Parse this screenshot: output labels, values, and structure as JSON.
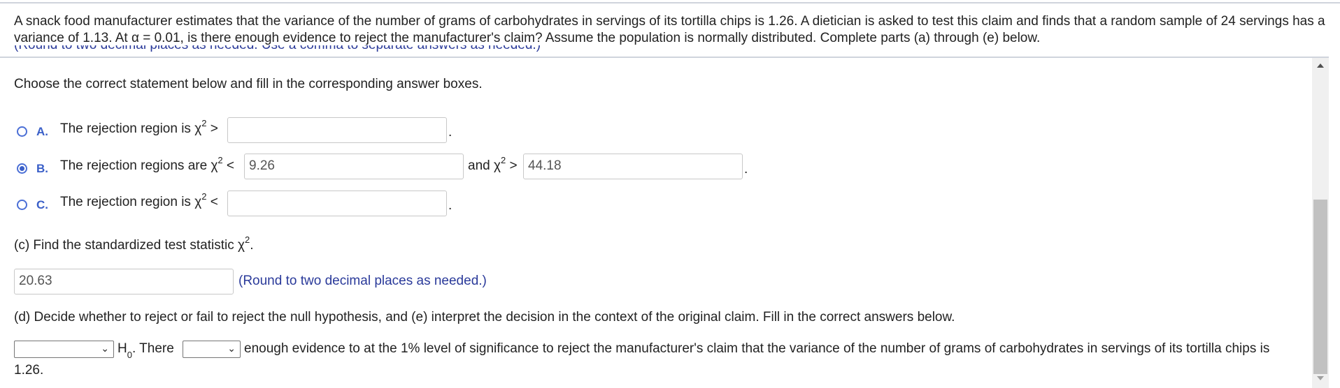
{
  "problem": {
    "text": "A snack food manufacturer estimates that the variance of the number of grams of carbohydrates in servings of its tortilla chips is 1.26. A dietician is asked to test this claim and finds that a random sample of 24 servings has a variance of 1.13. At α = 0.01, is there enough evidence to reject the manufacturer's claim? Assume the population is normally distributed. Complete parts (a) through (e) below."
  },
  "clipped_hint": "(Round to two decimal places as needed. Use a comma to separate answers as needed.)",
  "part_b": {
    "instruction": "Choose the correct statement below and fill in the corresponding answer boxes.",
    "options": [
      {
        "letter": "A.",
        "prefix": "The rejection region is χ",
        "sup": "2",
        "op": " >",
        "value": "",
        "selected": false
      },
      {
        "letter": "B.",
        "prefix": "The rejection regions are χ",
        "sup": "2",
        "op": " <",
        "value": "9.26",
        "mid_prefix": "and χ",
        "mid_sup": "2",
        "mid_op": " >",
        "value2": "44.18",
        "selected": true
      },
      {
        "letter": "C.",
        "prefix": "The rejection region is χ",
        "sup": "2",
        "op": " <",
        "value": "",
        "selected": false
      }
    ],
    "period": "."
  },
  "part_c": {
    "prompt": "(c) Find the standardized test statistic χ",
    "prompt_sup": "2",
    "prompt_end": ".",
    "value": "20.63",
    "hint": "(Round to two decimal places as needed.)"
  },
  "part_d": {
    "prompt": "(d) Decide whether to reject or fail to reject the null hypothesis, and (e) interpret the decision in the context of the original claim. Fill in the correct answers below.",
    "select1_value": "",
    "h0_label": "H",
    "h0_sub": "0",
    "there_label": ". There",
    "select2_value": "",
    "sentence_rest": "enough evidence to at the 1% level of significance to reject the manufacturer's claim that the variance of the number of grams of carbohydrates in servings of its tortilla chips is",
    "sentence_end": "1.26."
  }
}
